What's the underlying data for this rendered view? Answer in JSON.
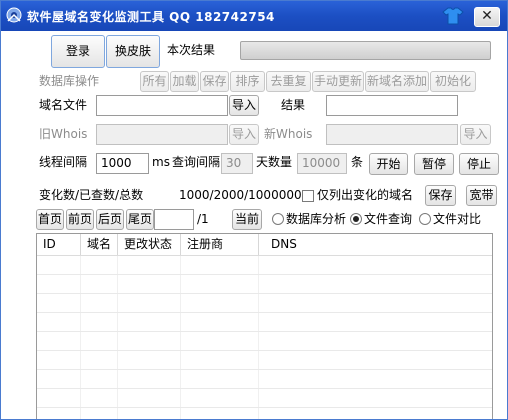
{
  "titlebar": {
    "title": "软件屋域名变化监测工具  QQ 182742754",
    "close_label": "✕"
  },
  "buttons": {
    "login": "登录",
    "change_skin": "换皮肤",
    "db_all": "所有",
    "db_load": "加载",
    "db_save": "保存",
    "db_sort": "排序",
    "db_dedup": "去重复",
    "db_manual_update": "手动更新",
    "db_add_new": "新域名添加",
    "db_init": "初始化",
    "import_domain": "导入",
    "import_old_whois": "导入",
    "import_new_whois": "导入",
    "start": "开始",
    "pause": "暂停",
    "stop": "停止",
    "save": "保存",
    "bandwidth": "宽带",
    "first_page": "首页",
    "prev_page": "前页",
    "next_page": "后页",
    "last_page": "尾页",
    "current": "当前"
  },
  "labels": {
    "current_result": "本次结果",
    "db_ops": "数据库操作",
    "domain_file": "域名文件",
    "result": "结果",
    "old_whois": "旧Whois",
    "new_whois": "新Whois",
    "thread_interval": "线程间隔",
    "ms": "ms",
    "query_interval": "查询间隔",
    "days_count": "天数量",
    "unit_items": "条",
    "stats_label": "变化数/已查数/总数",
    "stats_value": "1000/2000/1000000",
    "only_changed": "仅列出变化的域名",
    "page_total": "/1",
    "db_analysis": "数据库分析",
    "file_query": "文件查询",
    "file_compare": "文件对比"
  },
  "inputs": {
    "domain_file": "",
    "result": "",
    "old_whois": "",
    "new_whois": "",
    "thread_interval": "1000",
    "query_interval": "30",
    "count": "10000",
    "page": ""
  },
  "table": {
    "columns": [
      "ID",
      "域名",
      "更改状态",
      "注册商",
      "DNS"
    ]
  }
}
